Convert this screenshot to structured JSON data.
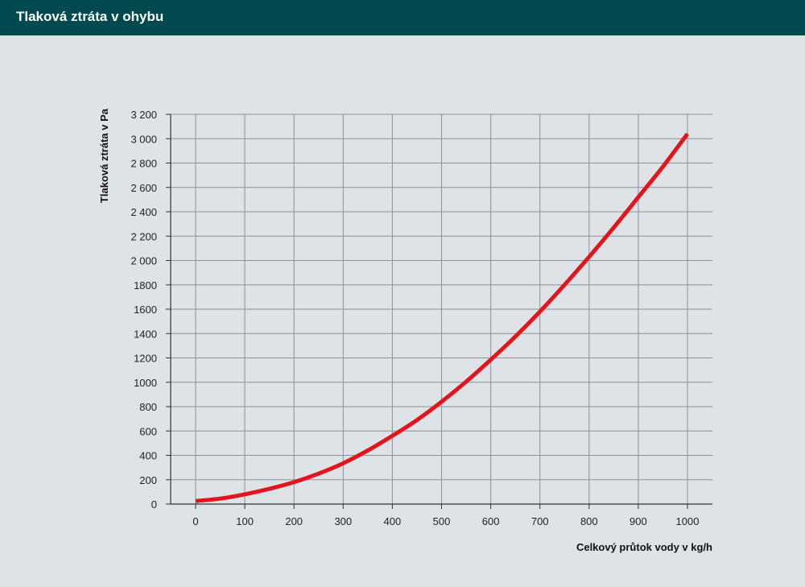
{
  "header": {
    "title": "Tlaková ztráta v ohybu"
  },
  "colors": {
    "header_bg": "#004a4f",
    "background": "#dde3e6",
    "curve": "#e3141b",
    "grid": "#8c9296"
  },
  "chart_data": {
    "type": "line",
    "title": "Tlaková ztráta v ohybu",
    "xlabel": "Celkový průtok vody v kg/h",
    "ylabel": "Tlaková ztráta v Pa",
    "xlim": [
      0,
      1000
    ],
    "ylim": [
      0,
      3200
    ],
    "x_ticks": [
      0,
      100,
      200,
      300,
      400,
      500,
      600,
      700,
      800,
      900,
      1000
    ],
    "x_tick_labels": [
      "0",
      "100",
      "200",
      "300",
      "400",
      "500",
      "600",
      "700",
      "800",
      "900",
      "1000"
    ],
    "y_ticks": [
      0,
      200,
      400,
      600,
      800,
      1000,
      1200,
      1400,
      1600,
      1800,
      2000,
      2200,
      2400,
      2600,
      2800,
      3000,
      3200
    ],
    "y_tick_labels": [
      "0",
      "200",
      "400",
      "600",
      "800",
      "1000",
      "1200",
      "1400",
      "1600",
      "1800",
      "2 000",
      "2 200",
      "2 400",
      "2 600",
      "2 800",
      "3 000",
      "3 200"
    ],
    "grid": true,
    "series": [
      {
        "x": [
          0,
          50,
          100,
          150,
          200,
          250,
          300,
          350,
          400,
          450,
          500,
          550,
          600,
          650,
          700,
          750,
          800,
          850,
          900,
          950,
          1000
        ],
        "y": [
          25,
          45,
          80,
          125,
          180,
          250,
          335,
          440,
          560,
          690,
          840,
          1005,
          1185,
          1375,
          1580,
          1800,
          2030,
          2270,
          2520,
          2770,
          3040
        ]
      }
    ]
  }
}
